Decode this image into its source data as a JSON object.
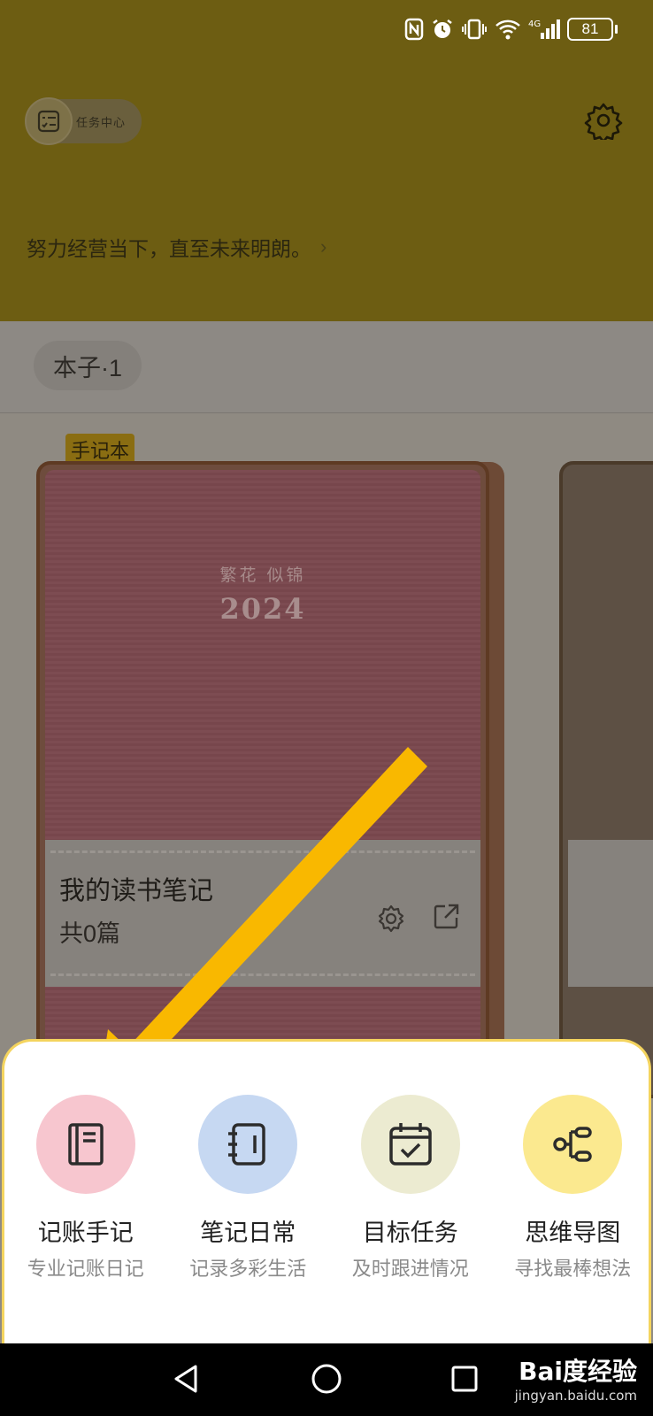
{
  "status_bar": {
    "battery": "81"
  },
  "header": {
    "task_center_label": "任务中心",
    "motto": "努力经营当下，直至未来明朗。",
    "motto_arrow": "›"
  },
  "tabs": {
    "notebooks_tab": "本子·1"
  },
  "notebook": {
    "tag": "手记本",
    "cover_subtitle": "繁花 似锦",
    "cover_year": "2024",
    "title": "我的读书笔记",
    "count": "共0篇"
  },
  "create_sheet": {
    "items": [
      {
        "title": "记账手记",
        "subtitle": "专业记账日记",
        "icon": "notebook-icon",
        "color": "#f7c6cf"
      },
      {
        "title": "笔记日常",
        "subtitle": "记录多彩生活",
        "icon": "binder-icon",
        "color": "#c6d8f2"
      },
      {
        "title": "目标任务",
        "subtitle": "及时跟进情况",
        "icon": "calendar-check-icon",
        "color": "#ecebd1"
      },
      {
        "title": "思维导图",
        "subtitle": "寻找最棒想法",
        "icon": "mindmap-icon",
        "color": "#fbe98f"
      }
    ]
  },
  "watermark": {
    "brand": "Bai度经验",
    "url": "jingyan.baidu.com"
  },
  "colors": {
    "sheet_border": "#f4d45e",
    "arrow": "#f9b800"
  }
}
